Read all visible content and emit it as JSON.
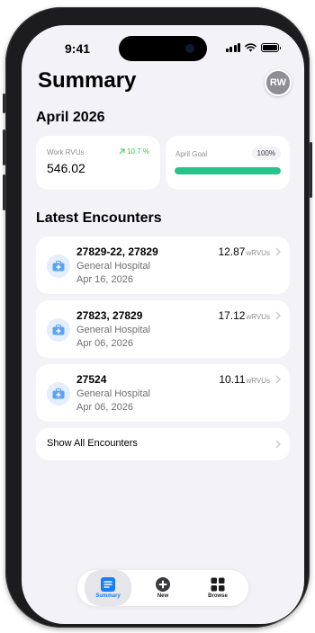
{
  "status_bar": {
    "time": "9:41"
  },
  "header": {
    "title": "Summary",
    "avatar_initials": "RW"
  },
  "period": {
    "heading": "April 2026"
  },
  "stats": {
    "work_rvus": {
      "label": "Work RVUs",
      "value": "546.02",
      "trend": "10.7 %",
      "trend_color": "#34c759"
    },
    "goal": {
      "label": "April Goal",
      "percent_text": "100%",
      "progress": 1.0,
      "bar_color": "#24c48b"
    }
  },
  "encounters": {
    "heading": "Latest Encounters",
    "items": [
      {
        "codes": "27829-22, 27829",
        "place": "General Hospital",
        "date": "Apr 16, 2026",
        "value": "12.87",
        "unit": "wRVUs",
        "icon": "medical-bag-icon"
      },
      {
        "codes": "27823, 27829",
        "place": "General Hospital",
        "date": "Apr 06, 2026",
        "value": "17.12",
        "unit": "wRVUs",
        "icon": "medical-bag-icon"
      },
      {
        "codes": "27524",
        "place": "General Hospital",
        "date": "Apr 06, 2026",
        "value": "10.11",
        "unit": "wRVUs",
        "icon": "medical-bag-icon"
      }
    ],
    "show_all_label": "Show All Encounters"
  },
  "tabbar": {
    "tabs": [
      {
        "label": "Summary",
        "icon": "summary-list-icon",
        "active": true
      },
      {
        "label": "New",
        "icon": "plus-circle-icon",
        "active": false
      },
      {
        "label": "Browse",
        "icon": "grid-icon",
        "active": false
      }
    ],
    "accent": "#1a7cf5"
  }
}
